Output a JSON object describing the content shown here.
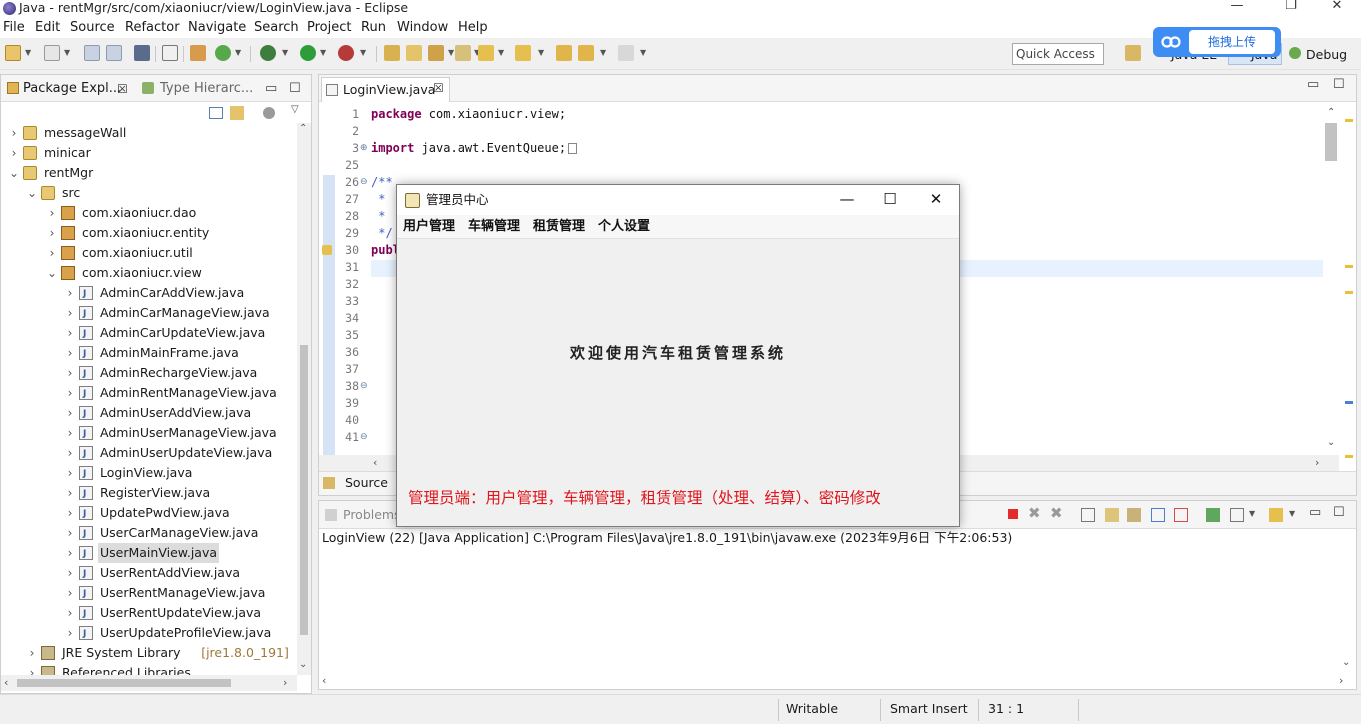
{
  "window": {
    "title": "Java - rentMgr/src/com/xiaoniucr/view/LoginView.java - Eclipse",
    "minimize_glyph": "—",
    "maximize_glyph": "❐",
    "close_glyph": "✕"
  },
  "menu": [
    "File",
    "Edit",
    "Source",
    "Refactor",
    "Navigate",
    "Search",
    "Project",
    "Run",
    "Window",
    "Help"
  ],
  "toolbar": {
    "quick_access_placeholder": "Quick Access",
    "perspective_java_ee": "Java EE",
    "perspective_java": "Java",
    "perspective_debug": "Debug"
  },
  "upload_widget": {
    "label": "拖拽上传"
  },
  "left_panel": {
    "tab_package_explorer": "Package Expl...",
    "tab_type_hierarchy": "Type Hierarc...",
    "tree": [
      {
        "label": "messageWall",
        "level": 0,
        "arrow": "›",
        "icon": "project"
      },
      {
        "label": "minicar",
        "level": 0,
        "arrow": "›",
        "icon": "project"
      },
      {
        "label": "rentMgr",
        "level": 0,
        "arrow": "⌄",
        "icon": "project"
      },
      {
        "label": "src",
        "level": 1,
        "arrow": "⌄",
        "icon": "src"
      },
      {
        "label": "com.xiaoniucr.dao",
        "level": 2,
        "arrow": "›",
        "icon": "pkg"
      },
      {
        "label": "com.xiaoniucr.entity",
        "level": 2,
        "arrow": "›",
        "icon": "pkg"
      },
      {
        "label": "com.xiaoniucr.util",
        "level": 2,
        "arrow": "›",
        "icon": "pkg"
      },
      {
        "label": "com.xiaoniucr.view",
        "level": 2,
        "arrow": "⌄",
        "icon": "pkg"
      },
      {
        "label": "AdminCarAddView.java",
        "level": 3,
        "arrow": "›",
        "icon": "java"
      },
      {
        "label": "AdminCarManageView.java",
        "level": 3,
        "arrow": "›",
        "icon": "java"
      },
      {
        "label": "AdminCarUpdateView.java",
        "level": 3,
        "arrow": "›",
        "icon": "java"
      },
      {
        "label": "AdminMainFrame.java",
        "level": 3,
        "arrow": "›",
        "icon": "java"
      },
      {
        "label": "AdminRechargeView.java",
        "level": 3,
        "arrow": "›",
        "icon": "java"
      },
      {
        "label": "AdminRentManageView.java",
        "level": 3,
        "arrow": "›",
        "icon": "java"
      },
      {
        "label": "AdminUserAddView.java",
        "level": 3,
        "arrow": "›",
        "icon": "java"
      },
      {
        "label": "AdminUserManageView.java",
        "level": 3,
        "arrow": "›",
        "icon": "java"
      },
      {
        "label": "AdminUserUpdateView.java",
        "level": 3,
        "arrow": "›",
        "icon": "java"
      },
      {
        "label": "LoginView.java",
        "level": 3,
        "arrow": "›",
        "icon": "java"
      },
      {
        "label": "RegisterView.java",
        "level": 3,
        "arrow": "›",
        "icon": "java"
      },
      {
        "label": "UpdatePwdView.java",
        "level": 3,
        "arrow": "›",
        "icon": "java"
      },
      {
        "label": "UserCarManageView.java",
        "level": 3,
        "arrow": "›",
        "icon": "java"
      },
      {
        "label": "UserMainView.java",
        "level": 3,
        "arrow": "›",
        "icon": "java",
        "selected": true
      },
      {
        "label": "UserRentAddView.java",
        "level": 3,
        "arrow": "›",
        "icon": "java"
      },
      {
        "label": "UserRentManageView.java",
        "level": 3,
        "arrow": "›",
        "icon": "java"
      },
      {
        "label": "UserRentUpdateView.java",
        "level": 3,
        "arrow": "›",
        "icon": "java"
      },
      {
        "label": "UserUpdateProfileView.java",
        "level": 3,
        "arrow": "›",
        "icon": "java"
      },
      {
        "label": "JRE System Library",
        "suffix": "[jre1.8.0_191]",
        "level": 1,
        "arrow": "›",
        "icon": "lib"
      },
      {
        "label": "Referenced Libraries",
        "level": 1,
        "arrow": "›",
        "icon": "lib"
      }
    ]
  },
  "editor": {
    "tab_label": "LoginView.java",
    "source_tab": "Source",
    "lines": [
      {
        "num": "1",
        "fold": "",
        "code": [
          [
            "kw",
            "package"
          ],
          [
            "",
            " com.xiaoniucr.view;"
          ]
        ]
      },
      {
        "num": "2",
        "fold": "",
        "code": []
      },
      {
        "num": "3",
        "fold": "⊕",
        "code": [
          [
            "kw",
            "import"
          ],
          [
            "",
            " java.awt.EventQueue;"
          ]
        ]
      },
      {
        "num": "25",
        "fold": "",
        "code": []
      },
      {
        "num": "26",
        "fold": "⊖",
        "code": [
          [
            "cm",
            "/**"
          ]
        ]
      },
      {
        "num": "27",
        "fold": "",
        "code": [
          [
            "cm",
            " *"
          ]
        ]
      },
      {
        "num": "28",
        "fold": "",
        "code": [
          [
            "cm",
            " *"
          ]
        ]
      },
      {
        "num": "29",
        "fold": "",
        "code": [
          [
            "cm",
            " */"
          ]
        ]
      },
      {
        "num": "30",
        "fold": "",
        "code": [
          [
            "kw",
            "publ"
          ]
        ]
      },
      {
        "num": "31",
        "fold": "",
        "code": []
      },
      {
        "num": "32",
        "fold": "",
        "code": []
      },
      {
        "num": "33",
        "fold": "",
        "code": []
      },
      {
        "num": "34",
        "fold": "",
        "code": []
      },
      {
        "num": "35",
        "fold": "",
        "code": []
      },
      {
        "num": "36",
        "fold": "",
        "code": []
      },
      {
        "num": "37",
        "fold": "",
        "code": []
      },
      {
        "num": "38",
        "fold": "⊖",
        "code": []
      },
      {
        "num": "39",
        "fold": "",
        "code": []
      },
      {
        "num": "40",
        "fold": "",
        "code": []
      },
      {
        "num": "41",
        "fold": "⊖",
        "code": []
      }
    ]
  },
  "console": {
    "tab_problems": "Problems",
    "launch_line": "LoginView (22) [Java Application] C:\\Program Files\\Java\\jre1.8.0_191\\bin\\javaw.exe (2023年9月6日 下午2:06:53)"
  },
  "status": {
    "writable": "Writable",
    "insert_mode": "Smart Insert",
    "cursor_pos": "31 : 1"
  },
  "dialog": {
    "title": "管理员中心",
    "menus": [
      "用户管理",
      "车辆管理",
      "租赁管理",
      "个人设置"
    ],
    "welcome": "欢迎使用汽车租赁管理系统",
    "minimize_glyph": "—",
    "maximize_glyph": "☐",
    "close_glyph": "✕"
  },
  "annotation": "管理员端：用户管理，车辆管理，租赁管理（处理、结算）、密码修改",
  "colors": {
    "keyword": "#7f0055",
    "comment": "#3f5fbf",
    "annotation_red": "#e0151b",
    "upload_blue": "#3d8df5"
  }
}
